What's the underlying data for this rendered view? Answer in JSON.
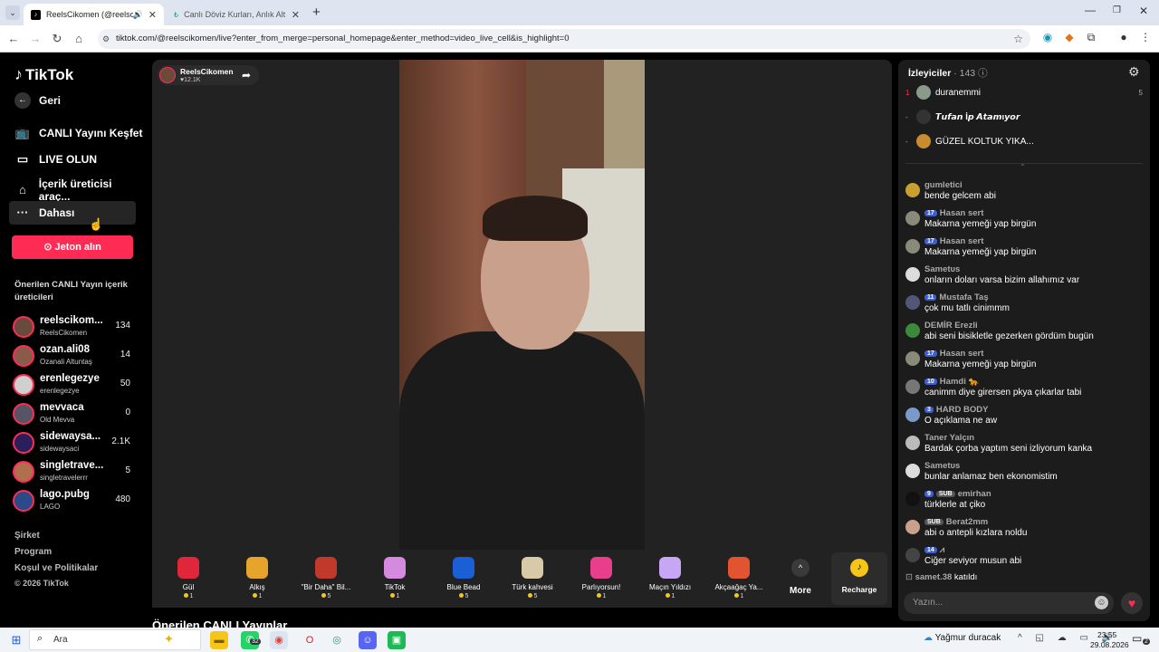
{
  "browser": {
    "tabs": [
      {
        "title": "ReelsCikomen (@reelscikomen)",
        "active": true
      },
      {
        "title": "Canlı Döviz Kurları, Anlık Altın F",
        "active": false
      }
    ],
    "new_tab": "+",
    "url": "tiktok.com/@reelscikomen/live?enter_from_merge=personal_homepage&enter_method=video_live_cell&is_highlight=0"
  },
  "sidebar": {
    "logo": "TikTok",
    "back_label": "Geri",
    "nav": [
      {
        "label": "CANLI Yayını Keşfet",
        "icon": "broadcast-icon"
      },
      {
        "label": "LIVE OLUN",
        "icon": "camera-icon"
      },
      {
        "label": "İçerik üreticisi araç...",
        "icon": "tools-icon"
      },
      {
        "label": "Dahası",
        "icon": "more-icon"
      }
    ],
    "coins_button": "Jeton alın",
    "suggested_title": "Önerilen CANLI Yayın içerik üreticileri",
    "suggested": [
      {
        "name": "reelscikom...",
        "sub": "ReelsCikomen",
        "count": "134"
      },
      {
        "name": "ozan.ali08",
        "sub": "Ozanali Altuntaş",
        "count": "14"
      },
      {
        "name": "erenlegezye",
        "sub": "erenlegezye",
        "count": "50"
      },
      {
        "name": "mevvaca",
        "sub": "Old Mevva",
        "count": "0"
      },
      {
        "name": "sidewaysa...",
        "sub": "sidewaysaci",
        "count": "2.1K"
      },
      {
        "name": "singletrave...",
        "sub": "singletravelerrr",
        "count": "5"
      },
      {
        "name": "lago.pubg",
        "sub": "LAGO",
        "count": "480"
      }
    ],
    "footer": [
      "Şirket",
      "Program",
      "Koşul ve Politikalar",
      "© 2026 TikTok"
    ]
  },
  "stream": {
    "host": "ReelsCikomen",
    "likes": "12.1K",
    "below_title": "Önerilen CANLI Yayınlar"
  },
  "gifts": [
    {
      "name": "Gül",
      "price": "1",
      "icon": "rose-icon",
      "color": "#e0263a"
    },
    {
      "name": "Alkış",
      "price": "1",
      "icon": "clap-icon",
      "color": "#e6a52a"
    },
    {
      "name": "\"Bir Daha\" Bil...",
      "price": "5",
      "icon": "sign-icon",
      "color": "#c0392b"
    },
    {
      "name": "TikTok",
      "price": "1",
      "icon": "tiktok-gift-icon",
      "color": "#d58ae0"
    },
    {
      "name": "Blue Bead",
      "price": "5",
      "icon": "bead-icon",
      "color": "#1a5fd6"
    },
    {
      "name": "Türk kahvesi",
      "price": "5",
      "icon": "coffee-icon",
      "color": "#d8c9a8"
    },
    {
      "name": "Parlıyorsun!",
      "price": "1",
      "icon": "heart-gift-icon",
      "color": "#e83e8c"
    },
    {
      "name": "Maçın Yıldızı",
      "price": "1",
      "icon": "star-icon",
      "color": "#c7a7f5"
    },
    {
      "name": "Akçaağaç Ya...",
      "price": "1",
      "icon": "maple-icon",
      "color": "#e2542f"
    }
  ],
  "more_label": "More",
  "recharge_label": "Recharge",
  "chat": {
    "viewers_label": "İzleyiciler",
    "viewers_count": "· 143",
    "top_viewers": [
      {
        "rank": "1",
        "name": "duranemmi",
        "score": "5"
      },
      {
        "rank": "-",
        "name": "𝙏𝙪𝙛𝙖𝙣 İ𝙥 𝘼𝙩𝙖𝙢ı𝙮𝙤𝙧",
        "score": ""
      },
      {
        "rank": "-",
        "name": "GÜZEL KOLTUK YIKA...",
        "score": ""
      }
    ],
    "messages": [
      {
        "user": "gumletici",
        "badges": [],
        "text": "bende gelcem abi"
      },
      {
        "user": "Hasan sert",
        "badges": [
          "17"
        ],
        "text": "Makarna yemeği yap birgün"
      },
      {
        "user": "Hasan sert",
        "badges": [
          "17"
        ],
        "text": "Makarna yemeği yap birgün"
      },
      {
        "user": "Sametᴜs",
        "badges": [],
        "text": "onların doları varsa bizim allahımız var"
      },
      {
        "user": "Mustafa Taş",
        "badges": [
          "11"
        ],
        "text": "çok mu tatlı cinimmm"
      },
      {
        "user": "DEMİR Erezli",
        "badges": [],
        "text": "abi seni bisikletle gezerken gördüm bugün"
      },
      {
        "user": "Hasan sert",
        "badges": [
          "17"
        ],
        "text": "Makarna yemeği yap birgün"
      },
      {
        "user": "Hamdi 🐆",
        "badges": [
          "10"
        ],
        "text": "canimm diye girersen pkya çıkarlar tabi"
      },
      {
        "user": "HARD BODY",
        "badges": [
          "3"
        ],
        "text": "O açıklama ne aw"
      },
      {
        "user": "Taner Yalçın",
        "badges": [],
        "text": "Bardak çorba yaptım seni izliyorum kanka"
      },
      {
        "user": "Sametᴜs",
        "badges": [],
        "text": "bunlar anlamaz ben ekonomistim"
      },
      {
        "user": "emirhan",
        "badges": [
          "9",
          "SUB"
        ],
        "text": "türklerle at çiko"
      },
      {
        "user": "Berat2mm",
        "badges": [
          "SUB"
        ],
        "text": "abi o antepli kızlara noldu"
      },
      {
        "user": "⩘",
        "badges": [
          "14"
        ],
        "text": "Ciğer seviyor musun abi"
      }
    ],
    "join_user": "samet.38",
    "join_text": "katıldı",
    "input_placeholder": "Yazın..."
  },
  "taskbar": {
    "search_placeholder": "Ara",
    "badge_count": "32",
    "weather": "Yağmur duracak",
    "time": "23:55",
    "date": "29.08.2026",
    "notif": "2"
  }
}
